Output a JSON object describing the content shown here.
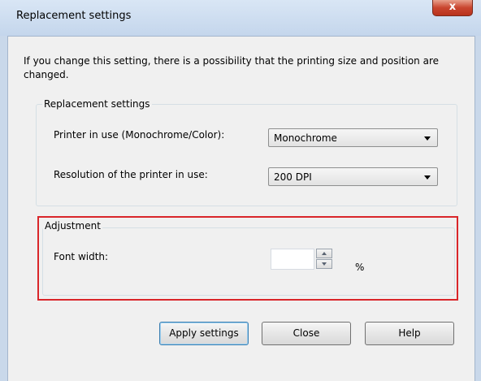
{
  "window": {
    "title": "Replacement settings",
    "close_glyph": "x"
  },
  "info": {
    "text": "If you change this setting, there is a possibility that the printing size and position are changed."
  },
  "replacement": {
    "group_label": "Replacement settings",
    "printer_label": "Printer in use (Monochrome/Color):",
    "printer_value": "Monochrome",
    "resolution_label": "Resolution of the printer in use:",
    "resolution_value": "200 DPI"
  },
  "adjustment": {
    "group_label": "Adjustment",
    "font_width_label": "Font width:",
    "font_width_value": "",
    "unit": "%",
    "highlight_color": "#d9262a"
  },
  "buttons": {
    "apply": "Apply settings",
    "close": "Close",
    "help": "Help"
  }
}
